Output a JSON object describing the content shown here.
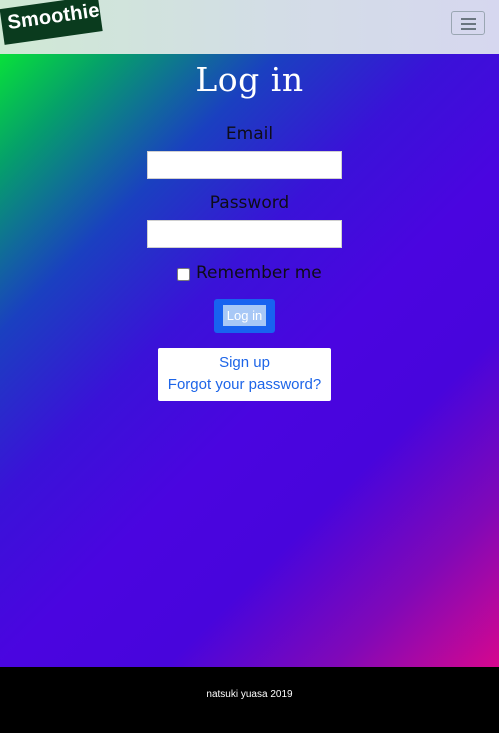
{
  "navbar": {
    "brand": "Smoothie",
    "menu_icon": "hamburger-icon"
  },
  "login": {
    "title": "Log in",
    "email_label": "Email",
    "email_value": "",
    "password_label": "Password",
    "password_value": "",
    "remember_label": "Remember me",
    "remember_checked": false,
    "submit_label": "Log in"
  },
  "links": {
    "sign_up": "Sign up",
    "forgot_password": "Forgot your password?"
  },
  "footer": {
    "text": "natsuki yuasa 2019"
  },
  "colors": {
    "primary_button": "#1863f0",
    "link": "#1d65e8",
    "footer_bg": "#000000",
    "brand_bg": "#0a3b1e"
  }
}
